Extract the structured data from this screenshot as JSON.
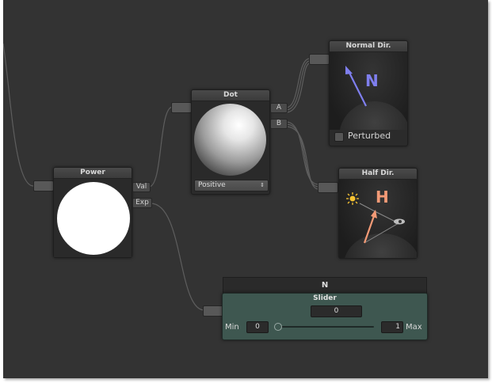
{
  "nodes": {
    "power": {
      "title": "Power",
      "outputs": [
        "Val",
        "Exp"
      ]
    },
    "dot": {
      "title": "Dot",
      "inputs": [
        "A",
        "B"
      ],
      "mode": "Positive"
    },
    "normal_dir": {
      "title": "Normal Dir.",
      "glyph": "N",
      "checkbox_label": "Perturbed",
      "checked": false
    },
    "half_dir": {
      "title": "Half Dir.",
      "glyph": "H"
    },
    "slider": {
      "header": "N",
      "title": "Slider",
      "value": "0",
      "min_label": "Min",
      "min_value": "0",
      "max_label": "Max",
      "max_value": "1",
      "level": 0.0
    }
  },
  "colors": {
    "canvas": "#333333",
    "normal_arrow": "#7f7fef",
    "half_arrow": "#f39a76",
    "sun": "#f5c232",
    "slider_bg": "#3e5750"
  }
}
